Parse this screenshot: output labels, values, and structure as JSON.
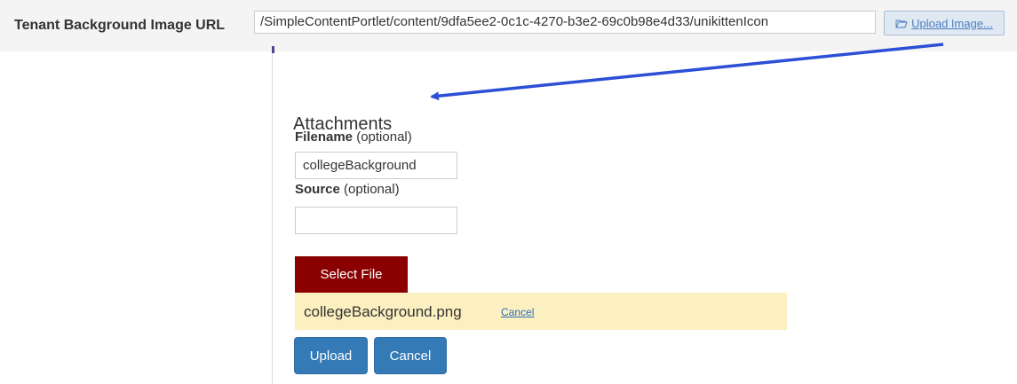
{
  "url_setting": {
    "label": "Tenant Background Image URL",
    "value": "/SimpleContentPortlet/content/9dfa5ee2-0c1c-4270-b3e2-69c0b98e4d33/unikittenIcon",
    "upload_button_label": "Upload Image...",
    "upload_button_icon": "folder-open-icon"
  },
  "attachments": {
    "title": "Attachments",
    "filename": {
      "label": "Filename",
      "optional_text": "(optional)",
      "value": "collegeBackground"
    },
    "source": {
      "label": "Source",
      "optional_text": "(optional)",
      "value": ""
    },
    "select_file_label": "Select File",
    "selected_file": {
      "name": "collegeBackground.png",
      "cancel_label": "Cancel"
    },
    "upload_label": "Upload",
    "cancel_label": "Cancel"
  },
  "colors": {
    "select_file_bg": "#8b0000",
    "primary_button_bg": "#337ab7",
    "file_row_bg": "#fcefc0",
    "annotation_arrow": "#2b4fd6"
  }
}
